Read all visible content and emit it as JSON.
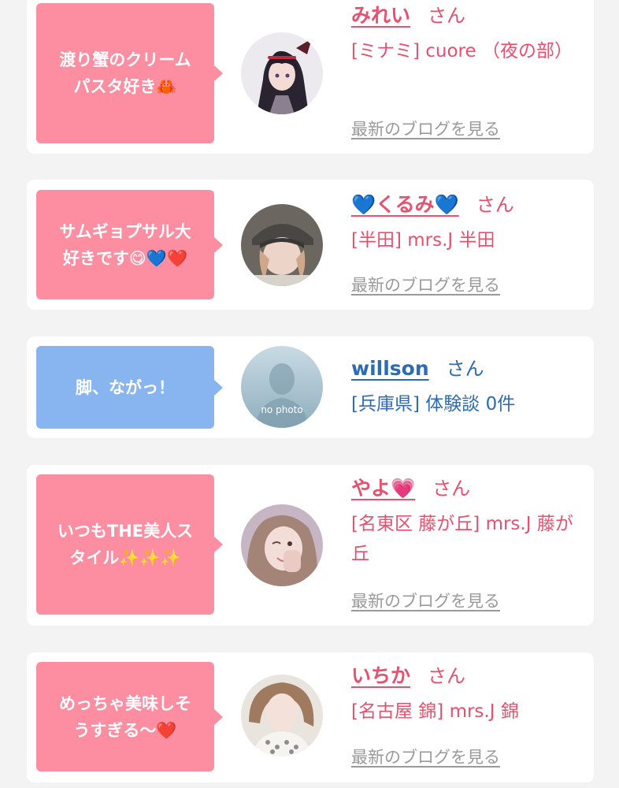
{
  "colors": {
    "pink": "#fd8da0",
    "blue": "#88b4f0",
    "name_pink": "#e8506e",
    "name_blue": "#2c6bb5",
    "link_gray": "#9a9a9a"
  },
  "cards": [
    {
      "comment": "渡り蟹のクリーム\nパスタ好き🦀",
      "name": "みれい",
      "honorific": "さん",
      "shop": "[ミナミ] cuore （夜の部）",
      "blog_link": "最新のブログを見る",
      "avatar_icon": "anime-girl-avatar"
    },
    {
      "comment": "サムギョプサル大\n好きです😋💙❤️",
      "name": "💙くるみ💙",
      "honorific": "さん",
      "shop": "[半田] mrs.J 半田",
      "blog_link": "最新のブログを見る",
      "avatar_icon": "woman-in-cap-avatar"
    },
    {
      "comment": "脚、ながっ！",
      "name": "willson",
      "honorific": "さん",
      "shop": "[兵庫県] 体験談 0件",
      "avatar_icon": "no-photo-avatar",
      "avatar_text": "no photo"
    },
    {
      "comment": "いつもTHE美人ス\nタイル✨✨✨",
      "name": "やよ💗",
      "honorific": "さん",
      "shop": "[名東区 藤が丘] mrs.J 藤が丘",
      "blog_link": "最新のブログを見る",
      "avatar_icon": "woman-winking-avatar"
    },
    {
      "comment": "めっちゃ美味しそ\nうすぎる〜❤️",
      "name": "いちか",
      "honorific": "さん",
      "shop": "[名古屋 錦] mrs.J 錦",
      "blog_link": "最新のブログを見る",
      "avatar_icon": "woman-lace-top-avatar"
    }
  ]
}
